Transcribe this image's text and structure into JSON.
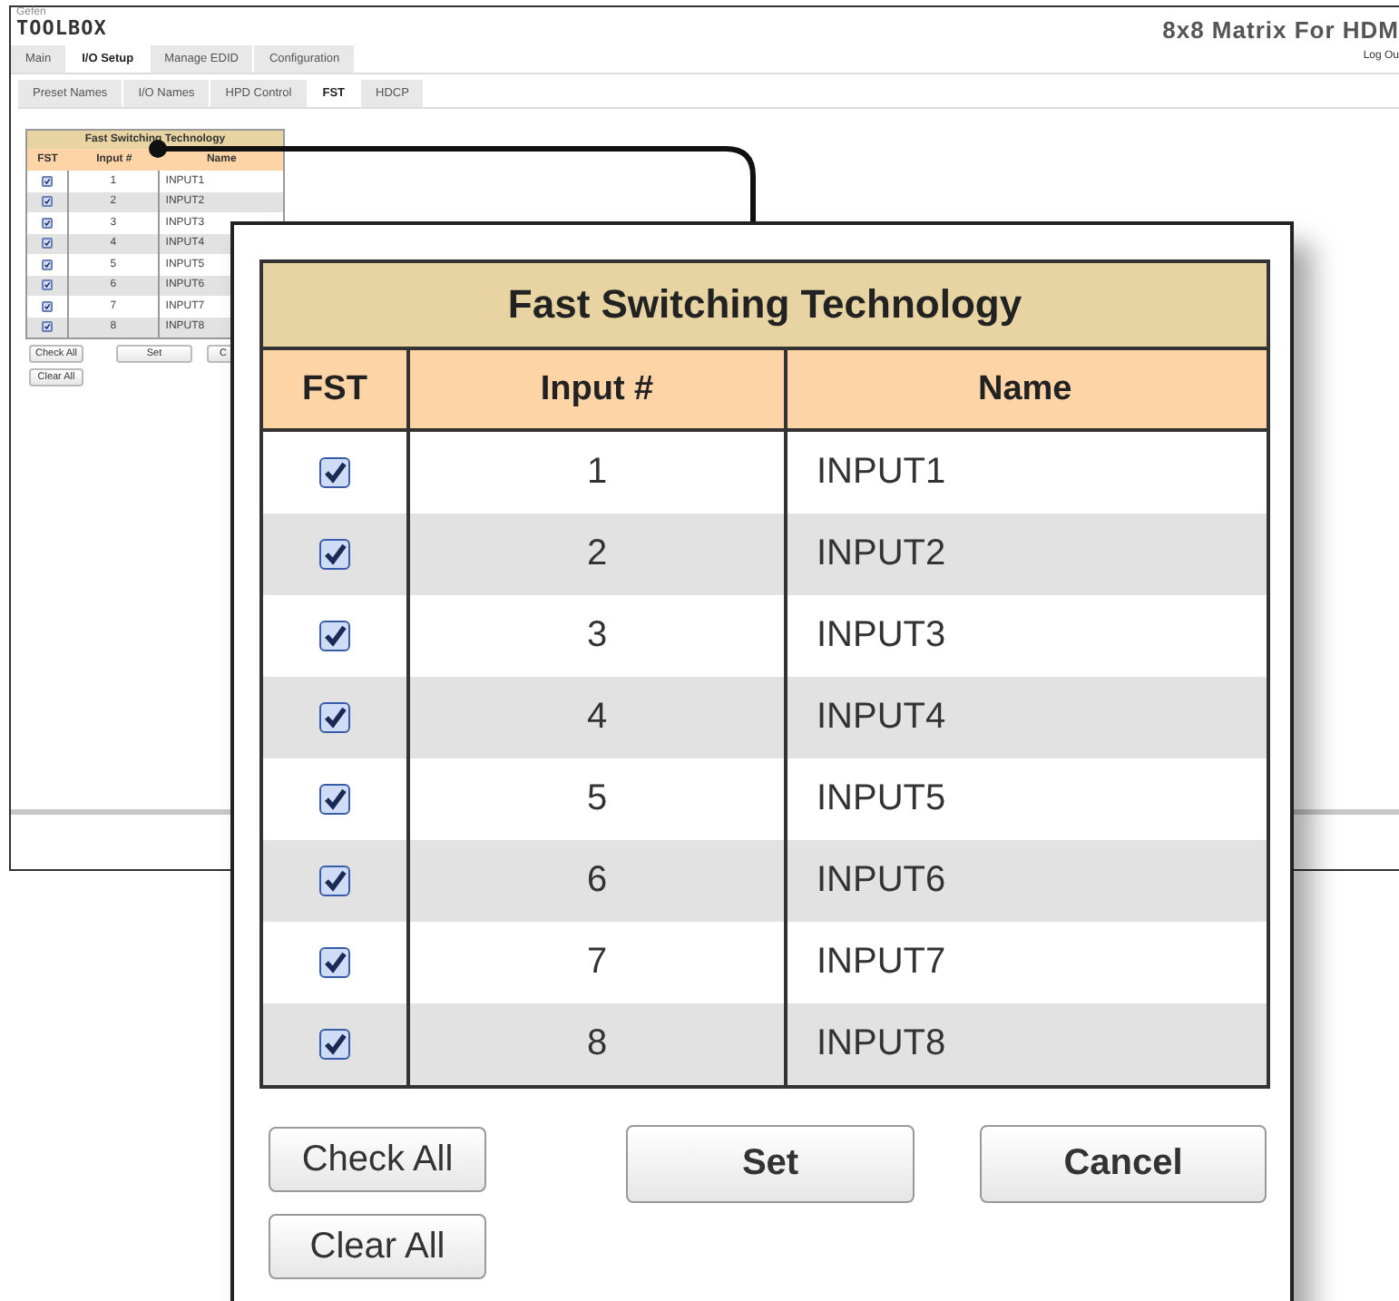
{
  "header": {
    "brand": "Gefen",
    "logo": "TOOLBOX",
    "title": "8x8 Matrix For HDM",
    "logout": "Log Ou"
  },
  "tabs": [
    {
      "label": "Main",
      "selected": false
    },
    {
      "label": "I/O Setup",
      "selected": true
    },
    {
      "label": "Manage EDID",
      "selected": false
    },
    {
      "label": "Configuration",
      "selected": false
    }
  ],
  "subtabs": [
    {
      "label": "Preset Names",
      "selected": false
    },
    {
      "label": "I/O Names",
      "selected": false
    },
    {
      "label": "HPD Control",
      "selected": false
    },
    {
      "label": "FST",
      "selected": true
    },
    {
      "label": "HDCP",
      "selected": false
    }
  ],
  "fst_panel": {
    "title": "Fast Switching Technology",
    "columns": [
      "FST",
      "Input #",
      "Name"
    ],
    "rows": [
      {
        "checked": true,
        "input": "1",
        "name": "INPUT1"
      },
      {
        "checked": true,
        "input": "2",
        "name": "INPUT2"
      },
      {
        "checked": true,
        "input": "3",
        "name": "INPUT3"
      },
      {
        "checked": true,
        "input": "4",
        "name": "INPUT4"
      },
      {
        "checked": true,
        "input": "5",
        "name": "INPUT5"
      },
      {
        "checked": true,
        "input": "6",
        "name": "INPUT6"
      },
      {
        "checked": true,
        "input": "7",
        "name": "INPUT7"
      },
      {
        "checked": true,
        "input": "8",
        "name": "INPUT8"
      }
    ],
    "buttons": [
      {
        "label": "Check All"
      },
      {
        "label": "Set"
      },
      {
        "label": "C"
      },
      {
        "label": "Clear All"
      }
    ]
  },
  "magnified_panel": {
    "title": "Fast Switching Technology",
    "columns": [
      "FST",
      "Input #",
      "Name"
    ],
    "rows": [
      {
        "checked": true,
        "input": "1",
        "name": "INPUT1"
      },
      {
        "checked": true,
        "input": "2",
        "name": "INPUT2"
      },
      {
        "checked": true,
        "input": "3",
        "name": "INPUT3"
      },
      {
        "checked": true,
        "input": "4",
        "name": "INPUT4"
      },
      {
        "checked": true,
        "input": "5",
        "name": "INPUT5"
      },
      {
        "checked": true,
        "input": "6",
        "name": "INPUT6"
      },
      {
        "checked": true,
        "input": "7",
        "name": "INPUT7"
      },
      {
        "checked": true,
        "input": "8",
        "name": "INPUT8"
      }
    ],
    "buttons": [
      {
        "label": "Check All"
      },
      {
        "label": "Set"
      },
      {
        "label": "Cancel"
      },
      {
        "label": "Clear All"
      }
    ]
  }
}
